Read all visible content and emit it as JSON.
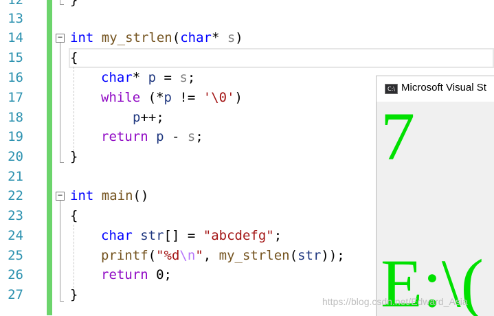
{
  "line_numbers": [
    "12",
    "13",
    "14",
    "15",
    "16",
    "17",
    "18",
    "19",
    "20",
    "21",
    "22",
    "23",
    "24",
    "25",
    "26",
    "27"
  ],
  "code": {
    "line12_brace": "}",
    "strlen_kw_int": "int",
    "strlen_name": "my_strlen",
    "strlen_open": "(",
    "strlen_kw_char": "char",
    "strlen_ptr": "* ",
    "strlen_param": "s",
    "strlen_close": ")",
    "open_brace_1": "{",
    "l16_kw_char": "char",
    "l16_rest_a": "* ",
    "l16_p": "p",
    "l16_eq": " = ",
    "l16_s": "s",
    "l16_semi": ";",
    "l17_kw_while": "while",
    "l17_open": " (*",
    "l17_p": "p",
    "l17_ne": " != ",
    "l17_char": "'\\0'",
    "l17_close": ")",
    "l18_p": "p",
    "l18_inc": "++;",
    "l19_kw_return": "return",
    "l19_sp": " ",
    "l19_p": "p",
    "l19_minus": " - ",
    "l19_s": "s",
    "l19_semi": ";",
    "close_brace_1": "}",
    "main_kw_int": "int",
    "main_name": "main",
    "main_parens": "()",
    "open_brace_2": "{",
    "l24_kw_char": "char",
    "l24_sp": " ",
    "l24_str": "str",
    "l24_arr": "[] = ",
    "l24_lit": "\"abcdefg\"",
    "l24_semi": ";",
    "l25_printf": "printf",
    "l25_open": "(",
    "l25_fmt_a": "\"%d",
    "l25_fmt_esc": "\\n",
    "l25_fmt_b": "\"",
    "l25_comma": ", ",
    "l25_call": "my_strlen",
    "l25_paren_open": "(",
    "l25_arg": "str",
    "l25_end": "));",
    "l26_kw_return": "return",
    "l26_rest": " 0;",
    "close_brace_2": "}"
  },
  "fold_toggle_symbol": "−",
  "console": {
    "title": "Microsoft Visual St",
    "icon_text": "C:\\",
    "output_line1": "7",
    "output_line2": "E:\\("
  },
  "watermark": "https://blog.csdn.net/Edward_Asia",
  "colors": {
    "keyword": "#0000ff",
    "control_keyword": "#8f08c4",
    "function": "#74531f",
    "string": "#a31515",
    "line_number": "#2b91af",
    "console_text": "#00e000",
    "change_bar": "#6cd46c"
  }
}
